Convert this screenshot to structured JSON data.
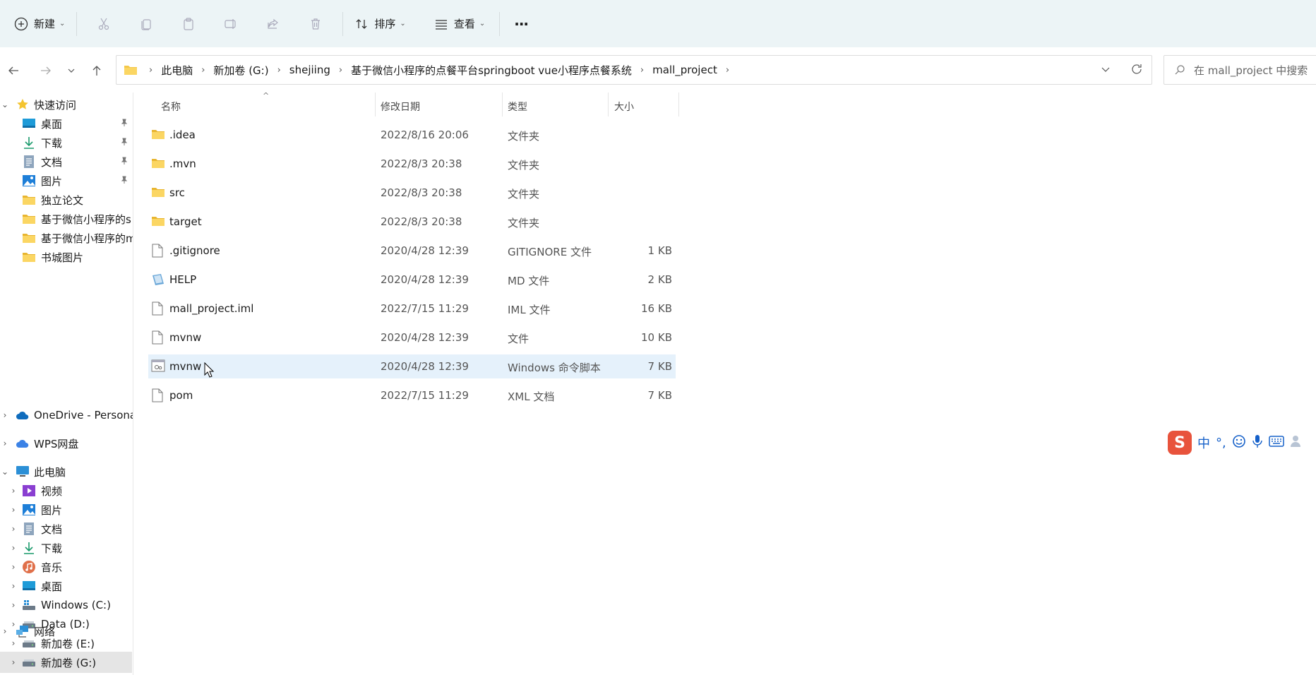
{
  "toolbar": {
    "new_label": "新建",
    "sort_label": "排序",
    "view_label": "查看",
    "more_label": "···"
  },
  "address": {
    "crumbs": [
      "此电脑",
      "新加卷 (G:)",
      "shejiing",
      "基于微信小程序的点餐平台springboot vue小程序点餐系统",
      "mall_project"
    ],
    "search_placeholder": "在 mall_project 中搜索"
  },
  "sidebar": {
    "quick_access": "快速访问",
    "quick_items": [
      {
        "label": "桌面",
        "icon": "desktop-icon",
        "pinned": true
      },
      {
        "label": "下载",
        "icon": "download-icon",
        "pinned": true
      },
      {
        "label": "文档",
        "icon": "document-icon",
        "pinned": true
      },
      {
        "label": "图片",
        "icon": "picture-icon",
        "pinned": true
      },
      {
        "label": "独立论文",
        "icon": "folder-icon",
        "pinned": false
      },
      {
        "label": "基于微信小程序的s",
        "icon": "folder-icon",
        "pinned": false
      },
      {
        "label": "基于微信小程序的m",
        "icon": "folder-icon",
        "pinned": false
      },
      {
        "label": "书城图片",
        "icon": "folder-icon",
        "pinned": false
      }
    ],
    "onedrive": "OneDrive - Persona",
    "wps": "WPS网盘",
    "this_pc": "此电脑",
    "pc_items": [
      {
        "label": "视频",
        "icon": "video-icon"
      },
      {
        "label": "图片",
        "icon": "picture-icon"
      },
      {
        "label": "文档",
        "icon": "document-icon"
      },
      {
        "label": "下载",
        "icon": "download-icon"
      },
      {
        "label": "音乐",
        "icon": "music-icon"
      },
      {
        "label": "桌面",
        "icon": "desktop-icon"
      },
      {
        "label": "Windows (C:)",
        "icon": "windows-drive-icon"
      },
      {
        "label": "Data (D:)",
        "icon": "drive-icon"
      },
      {
        "label": "新加卷 (E:)",
        "icon": "drive-icon"
      },
      {
        "label": "新加卷 (G:)",
        "icon": "drive-icon"
      }
    ],
    "network": "网络"
  },
  "columns": {
    "name": "名称",
    "date": "修改日期",
    "type": "类型",
    "size": "大小"
  },
  "files": [
    {
      "name": ".idea",
      "date": "2022/8/16 20:06",
      "type": "文件夹",
      "size": "",
      "icon": "folder-icon"
    },
    {
      "name": ".mvn",
      "date": "2022/8/3 20:38",
      "type": "文件夹",
      "size": "",
      "icon": "folder-icon"
    },
    {
      "name": "src",
      "date": "2022/8/3 20:38",
      "type": "文件夹",
      "size": "",
      "icon": "folder-icon"
    },
    {
      "name": "target",
      "date": "2022/8/3 20:38",
      "type": "文件夹",
      "size": "",
      "icon": "folder-icon"
    },
    {
      "name": ".gitignore",
      "date": "2020/4/28 12:39",
      "type": "GITIGNORE 文件",
      "size": "1 KB",
      "icon": "file-icon"
    },
    {
      "name": "HELP",
      "date": "2020/4/28 12:39",
      "type": "MD 文件",
      "size": "2 KB",
      "icon": "markdown-file-icon"
    },
    {
      "name": "mall_project.iml",
      "date": "2022/7/15 11:29",
      "type": "IML 文件",
      "size": "16 KB",
      "icon": "file-icon"
    },
    {
      "name": "mvnw",
      "date": "2020/4/28 12:39",
      "type": "文件",
      "size": "10 KB",
      "icon": "file-icon"
    },
    {
      "name": "mvnw",
      "date": "2020/4/28 12:39",
      "type": "Windows 命令脚本",
      "size": "7 KB",
      "icon": "script-file-icon"
    },
    {
      "name": "pom",
      "date": "2022/7/15 11:29",
      "type": "XML 文档",
      "size": "7 KB",
      "icon": "file-icon"
    }
  ],
  "ime": {
    "logo": "S",
    "lang": "中",
    "punct": "°,"
  }
}
